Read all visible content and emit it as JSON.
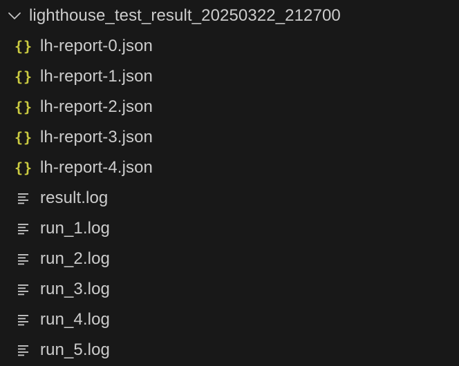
{
  "explorer": {
    "folder": {
      "name": "lighthouse_test_result_20250322_212700",
      "expanded": true
    },
    "files": [
      {
        "name": "lh-report-0.json",
        "icon": "json-braces-icon"
      },
      {
        "name": "lh-report-1.json",
        "icon": "json-braces-icon"
      },
      {
        "name": "lh-report-2.json",
        "icon": "json-braces-icon"
      },
      {
        "name": "lh-report-3.json",
        "icon": "json-braces-icon"
      },
      {
        "name": "lh-report-4.json",
        "icon": "json-braces-icon"
      },
      {
        "name": "result.log",
        "icon": "log-lines-icon"
      },
      {
        "name": "run_1.log",
        "icon": "log-lines-icon"
      },
      {
        "name": "run_2.log",
        "icon": "log-lines-icon"
      },
      {
        "name": "run_3.log",
        "icon": "log-lines-icon"
      },
      {
        "name": "run_4.log",
        "icon": "log-lines-icon"
      },
      {
        "name": "run_5.log",
        "icon": "log-lines-icon"
      }
    ],
    "json_icon_glyph": "{}",
    "colors": {
      "background": "#181818",
      "text": "#cccccc",
      "json_icon": "#cbcb41",
      "log_icon": "#cccccc"
    }
  }
}
